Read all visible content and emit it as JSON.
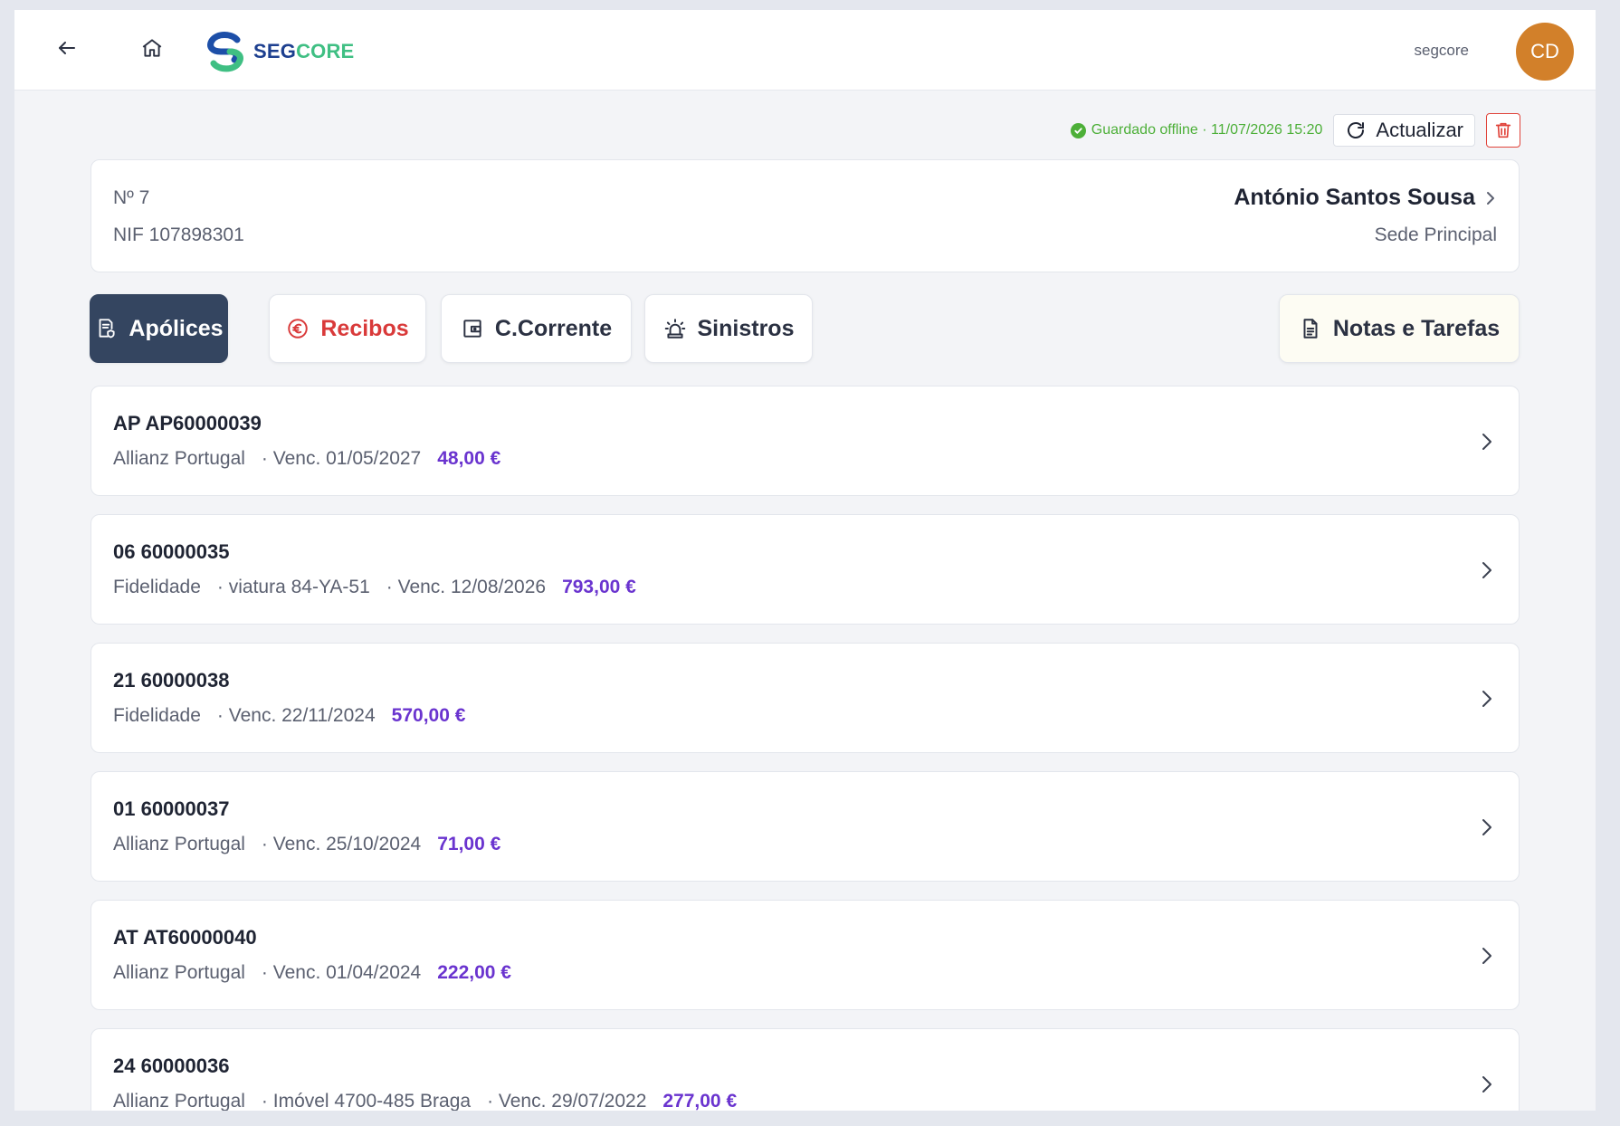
{
  "header": {
    "logo_text_seg": "SEG",
    "logo_text_core": "CORE",
    "user_name": "segcore",
    "avatar_initials": "CD"
  },
  "status": {
    "saved_text": "Guardado offline · 11/07/2026 15:20",
    "refresh_label": "Actualizar"
  },
  "client": {
    "number": "Nº 7",
    "nif": "NIF 107898301",
    "name": "António Santos Sousa",
    "branch": "Sede Principal"
  },
  "tabs": [
    {
      "label": "Apólices",
      "icon": "policy-document-icon",
      "active": true
    },
    {
      "label": "Recibos",
      "icon": "euro-circle-icon",
      "active": false
    },
    {
      "label": "C.Corrente",
      "icon": "wallet-icon",
      "active": false
    },
    {
      "label": "Sinistros",
      "icon": "siren-icon",
      "active": false
    },
    {
      "label": "Notas e Tarefas",
      "icon": "document-icon",
      "active": false
    }
  ],
  "policies": [
    {
      "id": "AP AP60000039",
      "meta": [
        "Allianz Portugal",
        "· Venc. 01/05/2027"
      ],
      "amount": "48,00 €"
    },
    {
      "id": "06 60000035",
      "meta": [
        "Fidelidade",
        "· viatura 84-YA-51",
        "· Venc. 12/08/2026"
      ],
      "amount": "793,00 €"
    },
    {
      "id": "21 60000038",
      "meta": [
        "Fidelidade",
        "· Venc. 22/11/2024"
      ],
      "amount": "570,00 €"
    },
    {
      "id": "01 60000037",
      "meta": [
        "Allianz Portugal",
        "· Venc. 25/10/2024"
      ],
      "amount": "71,00 €"
    },
    {
      "id": "AT AT60000040",
      "meta": [
        "Allianz Portugal",
        "· Venc. 01/04/2024"
      ],
      "amount": "222,00 €"
    },
    {
      "id": "24 60000036",
      "meta": [
        "Allianz Portugal",
        "· Imóvel 4700-485 Braga",
        "· Venc. 29/07/2022"
      ],
      "amount": "277,00 €"
    }
  ],
  "colors": {
    "accent_active_tab": "#344560",
    "amount": "#6a34cf",
    "saved_status": "#4caf38",
    "danger": "#d93a3a",
    "avatar": "#d2802a"
  }
}
